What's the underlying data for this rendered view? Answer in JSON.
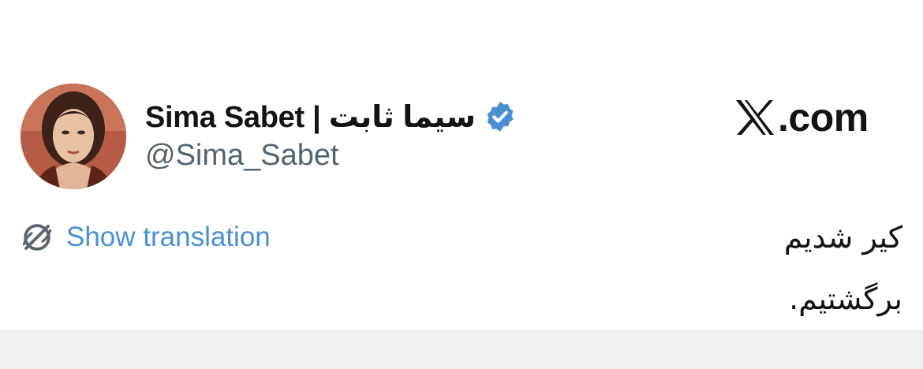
{
  "author": {
    "display_name": "Sima Sabet | سیما ثابت",
    "handle": "@Sima_Sabet",
    "verified": true,
    "verified_icon": "verified-badge-icon",
    "avatar_icon": "avatar-photo"
  },
  "site": {
    "logo_icon": "x-logo-icon",
    "domain": ".com"
  },
  "translation": {
    "icon": "translate-globe-icon",
    "label": "Show translation"
  },
  "tweet": {
    "lines": [
      "کیر شدیم",
      "برگشتیم."
    ]
  },
  "colors": {
    "text_primary": "#0f1419",
    "text_secondary": "#536471",
    "link": "#4a90d4",
    "verified_badge": "#4a90d4",
    "bottom_strip": "#f0f0f2"
  }
}
